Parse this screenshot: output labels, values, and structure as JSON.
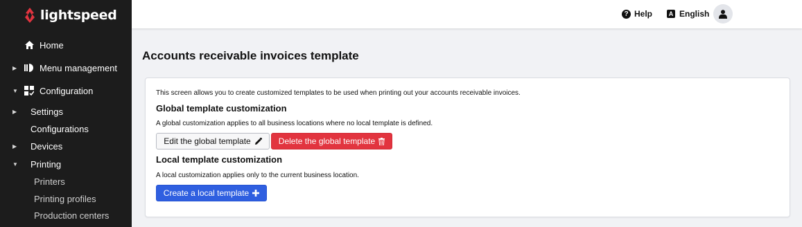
{
  "brand": {
    "name": "lightspeed",
    "accent": "#e2343f"
  },
  "sidebar": {
    "items": [
      {
        "label": "Home",
        "icon": "home-icon"
      },
      {
        "label": "Menu management",
        "icon": "menu-management-icon"
      },
      {
        "label": "Configuration",
        "icon": "configuration-icon"
      },
      {
        "label": "Settings"
      },
      {
        "label": "Configurations"
      },
      {
        "label": "Devices"
      },
      {
        "label": "Printing"
      },
      {
        "label": "Printers"
      },
      {
        "label": "Printing profiles"
      },
      {
        "label": "Production centers"
      }
    ]
  },
  "topbar": {
    "help": "Help",
    "language": "English"
  },
  "page": {
    "title": "Accounts receivable invoices template",
    "intro": "This screen allows you to create customized templates to be used when printing out your accounts receivable invoices.",
    "global": {
      "heading": "Global template customization",
      "description": "A global customization applies to all business locations where no local template is defined.",
      "edit_label": "Edit the global template",
      "delete_label": "Delete the global template"
    },
    "local": {
      "heading": "Local template customization",
      "description": "A local customization applies only to the current business location.",
      "create_label": "Create a local template"
    }
  }
}
